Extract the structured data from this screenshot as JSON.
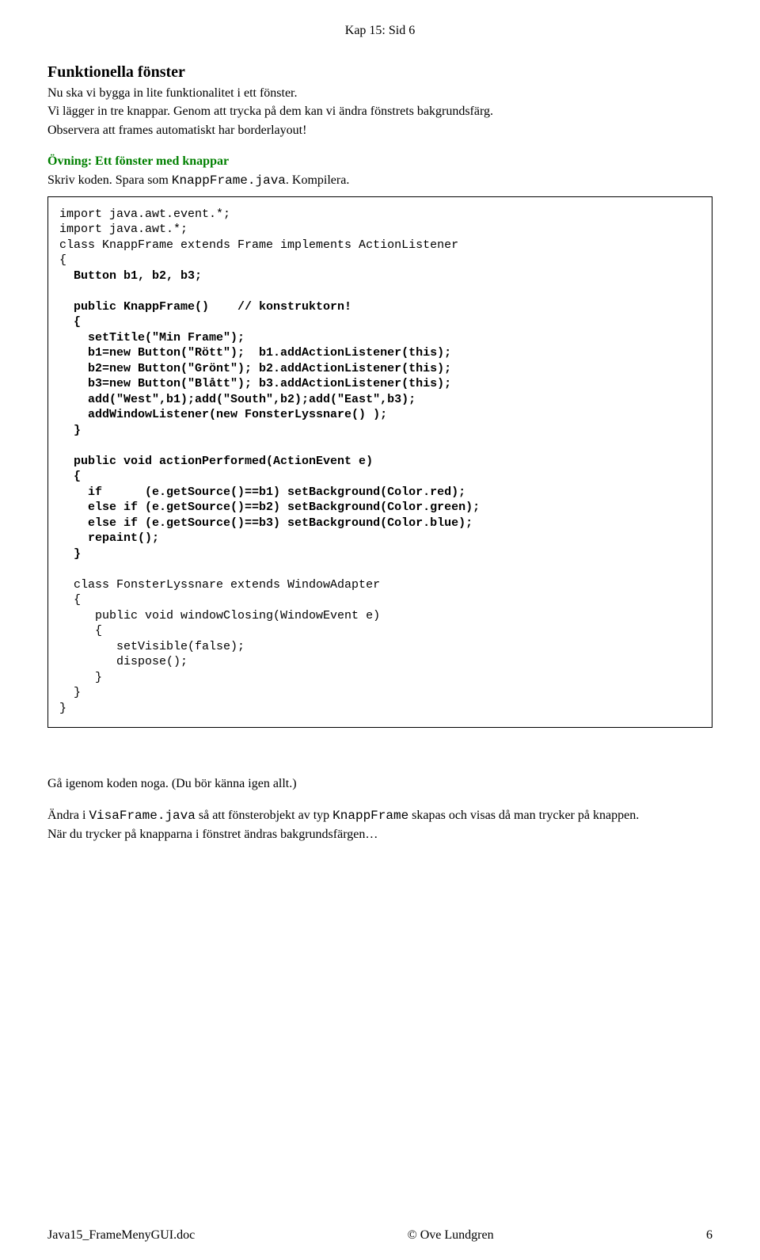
{
  "header": {
    "chapterPage": "Kap 15:  Sid 6"
  },
  "sectionHeading": "Funktionella fönster",
  "intro": {
    "p1": "Nu ska vi bygga in lite funktionalitet i ett fönster.",
    "p2": "Vi lägger in tre knappar. Genom att trycka på dem kan vi ändra fönstrets bakgrundsfärg.",
    "p3": "Observera att frames automatiskt har borderlayout!"
  },
  "exercise": {
    "label": "Övning:  Ett fönster med knappar",
    "line_pre": "Skriv koden. Spara som ",
    "line_code": "KnappFrame.java",
    "line_post": ". Kompilera."
  },
  "code": {
    "l01": "import java.awt.event.*;",
    "l02": "import java.awt.*;",
    "l03": "class KnappFrame extends Frame implements ActionListener",
    "l04": "{",
    "l05": "  Button b1, b2, b3;",
    "l06": "  public KnappFrame()    // konstruktorn!",
    "l07": "  {",
    "l08": "    setTitle(\"Min Frame\");",
    "l09": "    b1=new Button(\"Rött\");  b1.addActionListener(this);",
    "l10": "    b2=new Button(\"Grönt\"); b2.addActionListener(this);",
    "l11": "    b3=new Button(\"Blått\"); b3.addActionListener(this);",
    "l12": "    add(\"West\",b1);add(\"South\",b2);add(\"East\",b3);",
    "l13": "    addWindowListener(new FonsterLyssnare() );",
    "l14": "  }",
    "l15": "  public void actionPerformed(ActionEvent e)",
    "l16": "  {",
    "l17": "    if      (e.getSource()==b1) setBackground(Color.red);",
    "l18": "    else if (e.getSource()==b2) setBackground(Color.green);",
    "l19": "    else if (e.getSource()==b3) setBackground(Color.blue);",
    "l20": "    repaint();",
    "l21": "  }",
    "l22": "  class FonsterLyssnare extends WindowAdapter",
    "l23": "  {",
    "l24": "     public void windowClosing(WindowEvent e)",
    "l25": "     {",
    "l26": "        setVisible(false);",
    "l27": "        dispose();",
    "l28": "     }",
    "l29": "  }",
    "l30": "}"
  },
  "post": {
    "p1": "Gå igenom koden noga. (Du bör känna igen allt.)",
    "p2_pre": "Ändra i ",
    "p2_code1": "VisaFrame.java",
    "p2_mid": " så att fönsterobjekt av typ ",
    "p2_code2": "KnappFrame",
    "p2_post": " skapas och visas då man trycker på knappen.",
    "p3": "När du trycker på knapparna i fönstret ändras bakgrundsfärgen…"
  },
  "footer": {
    "left": "Java15_FrameMenyGUI.doc",
    "center": "© Ove Lundgren",
    "right": "6"
  }
}
